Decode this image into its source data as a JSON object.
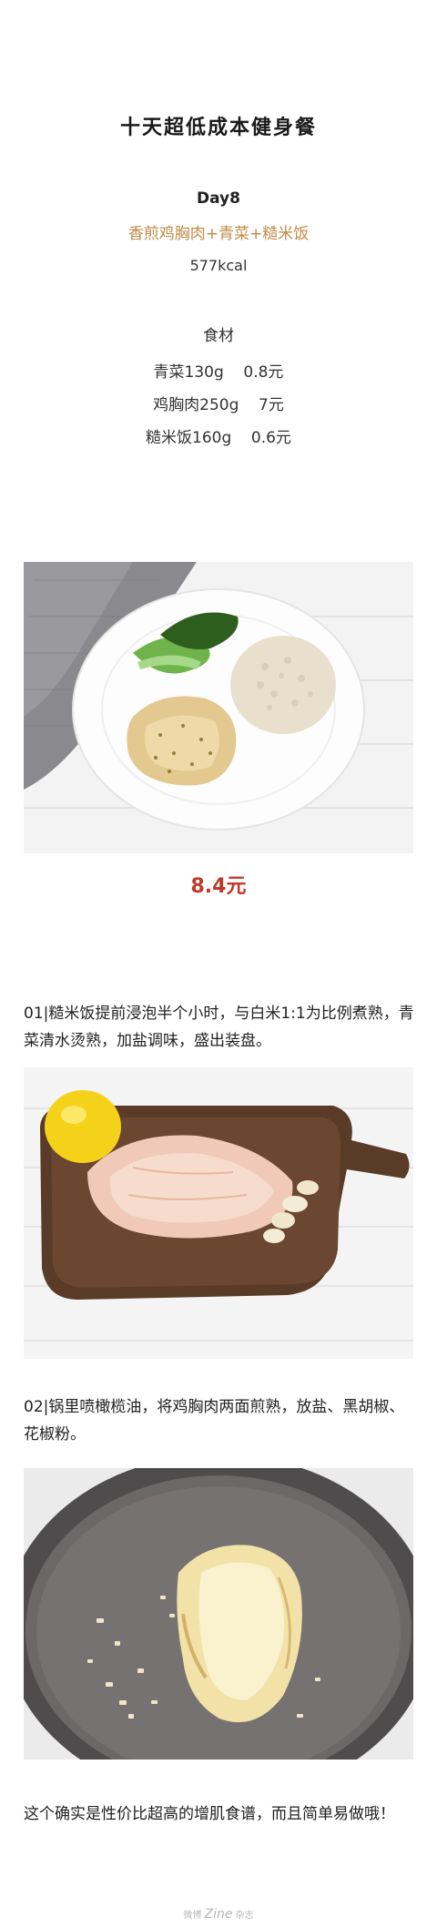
{
  "article": {
    "title": "十天超低成本健身餐",
    "day": "Day8",
    "dish": "香煎鸡胸肉+青菜+糙米饭",
    "kcal": "577kcal",
    "ingredients_heading": "食材",
    "ingredients": [
      "青菜130g    0.8元",
      "鸡胸肉250g    7元",
      "糙米饭160g    0.6元"
    ],
    "price": "8.4元",
    "steps": [
      "01|糙米饭提前浸泡半个小时，与白米1:1为比例煮熟，青菜清水烫熟，加盐调味，盛出装盘。",
      "02|锅里喷橄榄油，将鸡胸肉两面煎熟，放盐、黑胡椒、花椒粉。"
    ],
    "closing": "这个确实是性价比超高的增肌食谱，而且简单易做哦！"
  },
  "watermark": {
    "prefix": "微博",
    "brand": "Zine",
    "suffix": "杂志"
  },
  "images": [
    {
      "name": "plated-meal-photo",
      "icon": "photo-icon"
    },
    {
      "name": "raw-chicken-board-photo",
      "icon": "photo-icon"
    },
    {
      "name": "chicken-in-pan-photo",
      "icon": "photo-icon"
    }
  ],
  "colors": {
    "accent": "#c08a45",
    "price": "#c0392b",
    "text": "#222222"
  }
}
